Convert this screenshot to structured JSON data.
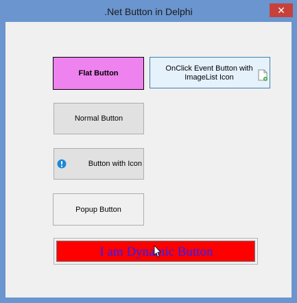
{
  "window": {
    "title": ".Net Button in Delphi",
    "close_glyph": "✕"
  },
  "buttons": {
    "flat": "Flat Button",
    "onclick": "OnClick Event Button with ImageList Icon",
    "onclick_icon": "document-add-icon",
    "normal": "Normal Button",
    "with_icon": "Button with Icon",
    "with_icon_icon": "info-icon",
    "popup": "Popup Button",
    "dynamic": "I am Dynamic Button"
  },
  "colors": {
    "flat_bg": "#ee82ee",
    "dynamic_bg": "#ff0000",
    "dynamic_text": "#2323ff",
    "info_icon": "#1e88d6",
    "close_bg": "#c7413a"
  }
}
